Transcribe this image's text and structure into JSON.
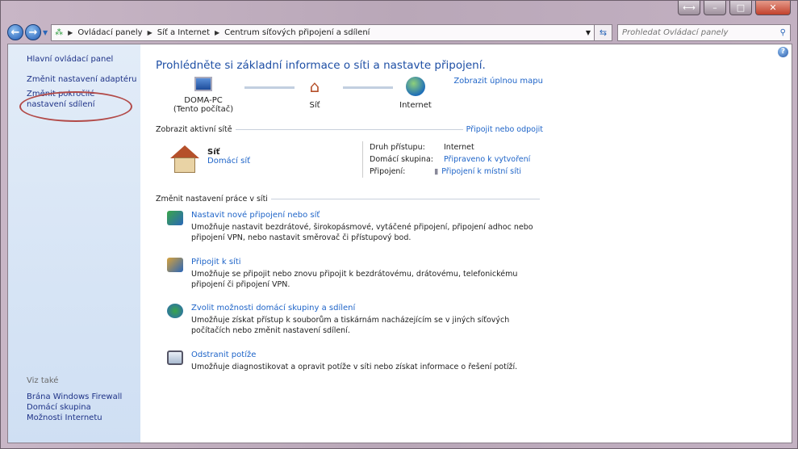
{
  "window": {
    "minimize": "–",
    "maximize": "□",
    "close": "✕",
    "snap": "⟷"
  },
  "nav": {
    "back": "←",
    "forward": "→",
    "breadcrumb": [
      "Ovládací panely",
      "Síť a Internet",
      "Centrum síťových připojení a sdílení"
    ],
    "search_placeholder": "Prohledat Ovládací panely"
  },
  "sidebar": {
    "items": [
      "Hlavní ovládací panel",
      "Změnit nastavení adaptéru",
      "Změnit pokročilé nastavení sdílení"
    ],
    "see_also_label": "Viz také",
    "see_also": [
      "Brána Windows Firewall",
      "Domácí skupina",
      "Možnosti Internetu"
    ]
  },
  "main": {
    "title": "Prohlédněte si základní informace o síti a nastavte připojení.",
    "full_map": "Zobrazit úplnou mapu",
    "map": {
      "pc_name": "DOMA-PC",
      "pc_sub": "(Tento počítač)",
      "network": "Síť",
      "internet": "Internet"
    },
    "active_header": "Zobrazit aktivní sítě",
    "connect_link": "Připojit nebo odpojit",
    "network": {
      "name": "Síť",
      "type": "Domácí síť"
    },
    "details": [
      {
        "k": "Druh přístupu:",
        "v": "Internet"
      },
      {
        "k": "Domácí skupina:",
        "v": "Připraveno k vytvoření"
      },
      {
        "k": "Připojení:",
        "v": "Připojení k místní síti"
      }
    ],
    "change_header": "Změnit nastavení práce v síti",
    "tasks": [
      {
        "title": "Nastavit nové připojení nebo síť",
        "desc": "Umožňuje nastavit bezdrátové, širokopásmové, vytáčené připojení, připojení adhoc nebo připojení VPN, nebo nastavit směrovač či přístupový bod."
      },
      {
        "title": "Připojit k síti",
        "desc": "Umožňuje se připojit nebo znovu připojit k bezdrátovému, drátovému, telefonickému připojení či připojení VPN."
      },
      {
        "title": "Zvolit možnosti domácí skupiny a sdílení",
        "desc": "Umožňuje získat přístup k souborům a tiskárnám nacházejícím se v jiných síťových počítačích nebo změnit nastavení sdílení."
      },
      {
        "title": "Odstranit potíže",
        "desc": "Umožňuje diagnostikovat a opravit potíže v síti nebo získat informace o řešení potíží."
      }
    ]
  }
}
